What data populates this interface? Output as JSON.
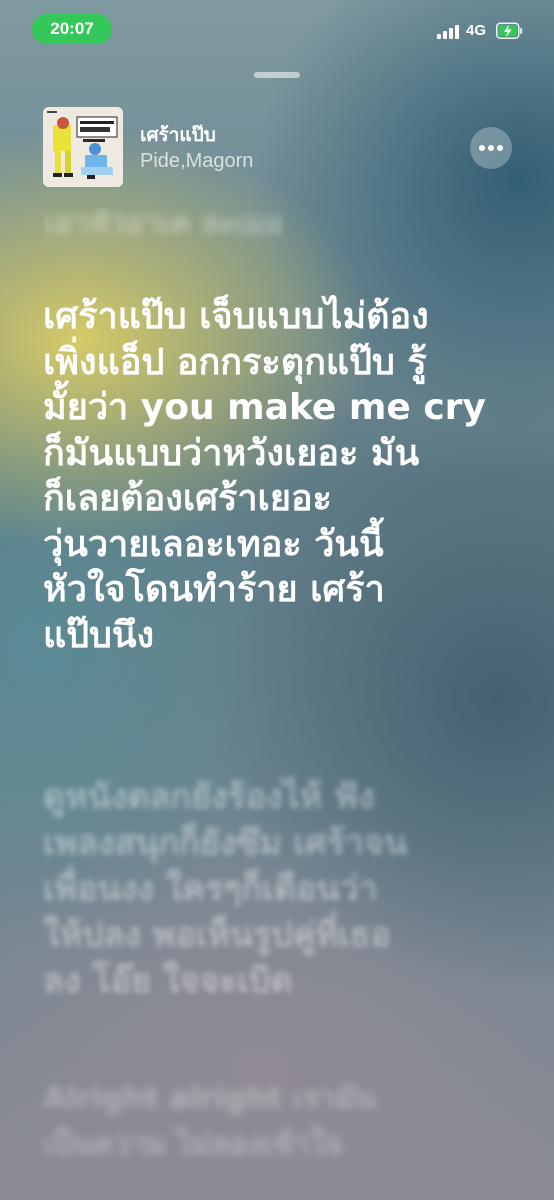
{
  "status_bar": {
    "time": "20:07",
    "network": "4G",
    "signal_bars": 4,
    "battery": "charging",
    "accent_color": "#34c759"
  },
  "now_playing": {
    "title": "เศร้าแป๊บ",
    "artist": "Pide,Magorn",
    "cover_icon": "album-art",
    "more_icon": "ellipsis-icon"
  },
  "lyrics": {
    "previous_fragment": "เอาหัวอาเค ละเมอ",
    "current": [
      "เศร้าแป๊บ เจ็บแบบไม่ต้อง",
      "เพิ่งแอ็ป อกกระตุกแป๊บ รู้",
      "มั้ยว่า you make me cry",
      "ก็มันแบบว่าหวังเยอะ มัน",
      "ก็เลยต้องเศร้าเยอะ",
      "วุ่นวายเลอะเทอะ วันนี้",
      "หัวใจโดนทำร้าย เศร้า",
      "แป๊บนึง"
    ],
    "next": [
      "ดูหนังตลกยังร้องไห้ ฟัง",
      "เพลงสนุกก็ยังซึม เศร้าจน",
      "เพื่อนงง ใครๆก็เตือนว่า",
      "ให้ปลง พอเห็นรูปคู่ที่เธอ",
      "ลง โอ๊ย ใจจะเบิด"
    ],
    "next2": [
      "Alright alright เรามัน",
      "เป็นความ ไม่ลองเข้าใจ"
    ]
  }
}
